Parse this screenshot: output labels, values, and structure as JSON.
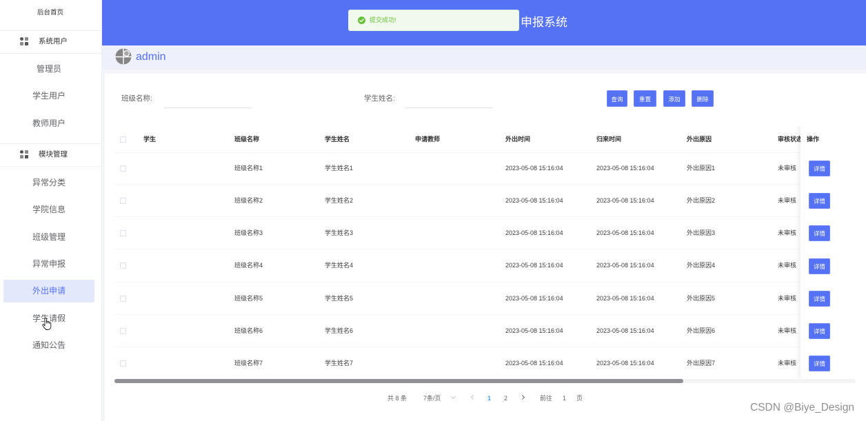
{
  "colors": {
    "primary": "#5571f4",
    "subheader_bg": "#eef0fb",
    "active_bg": "#e3e8fb",
    "toast_bg": "#f0f9eb",
    "success": "#67c23a",
    "text_main": "#303133",
    "text_regular": "#606266",
    "page_active": "#409eff"
  },
  "sidebar": {
    "home_label": "后台首页",
    "groups": [
      {
        "title": "系统用户",
        "icon": "grid-icon",
        "items": [
          {
            "label": "管理员"
          },
          {
            "label": "学生用户"
          },
          {
            "label": "教师用户"
          }
        ]
      },
      {
        "title": "模块管理",
        "icon": "grid-icon",
        "items": [
          {
            "label": "异常分类"
          },
          {
            "label": "学院信息"
          },
          {
            "label": "班级管理"
          },
          {
            "label": "异常申报"
          },
          {
            "label": "外出申请",
            "active": true
          },
          {
            "label": "学生请假"
          },
          {
            "label": "通知公告"
          }
        ]
      }
    ]
  },
  "header": {
    "title": "申报系统"
  },
  "toast": {
    "icon": "check-circle-icon",
    "message": "提交成功!"
  },
  "user": {
    "avatar_icon": "avatar-icon",
    "name": "admin"
  },
  "search": {
    "fields": [
      {
        "label": "班级名称:",
        "value": ""
      },
      {
        "label": "学生姓名:",
        "value": ""
      }
    ],
    "buttons": {
      "query": "查询",
      "reset": "重置",
      "add": "添加",
      "delete": "删除"
    }
  },
  "table": {
    "select_all_checked": false,
    "columns": [
      "学生",
      "班级名称",
      "学生姓名",
      "申请教师",
      "外出时间",
      "归来时间",
      "外出原因",
      "审核状态"
    ],
    "action_column": "操作",
    "action_label": "详情",
    "rows": [
      {
        "student": "",
        "class_name": "班级名称1",
        "student_name": "学生姓名1",
        "teacher": "",
        "out_time": "2023-05-08 15:16:04",
        "return_time": "2023-05-08 15:16:04",
        "reason": "外出原因1",
        "status": "未审核"
      },
      {
        "student": "",
        "class_name": "班级名称2",
        "student_name": "学生姓名2",
        "teacher": "",
        "out_time": "2023-05-08 15:16:04",
        "return_time": "2023-05-08 15:16:04",
        "reason": "外出原因2",
        "status": "未审核"
      },
      {
        "student": "",
        "class_name": "班级名称3",
        "student_name": "学生姓名3",
        "teacher": "",
        "out_time": "2023-05-08 15:16:04",
        "return_time": "2023-05-08 15:16:04",
        "reason": "外出原因3",
        "status": "未审核"
      },
      {
        "student": "",
        "class_name": "班级名称4",
        "student_name": "学生姓名4",
        "teacher": "",
        "out_time": "2023-05-08 15:16:04",
        "return_time": "2023-05-08 15:16:04",
        "reason": "外出原因4",
        "status": "未审核"
      },
      {
        "student": "",
        "class_name": "班级名称5",
        "student_name": "学生姓名5",
        "teacher": "",
        "out_time": "2023-05-08 15:16:04",
        "return_time": "2023-05-08 15:16:04",
        "reason": "外出原因5",
        "status": "未审核"
      },
      {
        "student": "",
        "class_name": "班级名称6",
        "student_name": "学生姓名6",
        "teacher": "",
        "out_time": "2023-05-08 15:16:04",
        "return_time": "2023-05-08 15:16:04",
        "reason": "外出原因6",
        "status": "未审核"
      },
      {
        "student": "",
        "class_name": "班级名称7",
        "student_name": "学生姓名7",
        "teacher": "",
        "out_time": "2023-05-08 15:16:04",
        "return_time": "2023-05-08 15:16:04",
        "reason": "外出原因7",
        "status": "未审核"
      }
    ]
  },
  "pagination": {
    "total_text": "共 8 条",
    "page_size_text": "7条/页",
    "dropdown_icon": "chevron-down-icon",
    "prev_icon": "chevron-left-icon",
    "pages": [
      "1",
      "2"
    ],
    "current_page": 1,
    "next_icon": "chevron-right-icon",
    "goto_label": "前往",
    "goto_value": "1",
    "page_unit": "页"
  },
  "watermark": "CSDN @Biye_Design",
  "cursor": {
    "icon": "hand-pointer-icon"
  }
}
